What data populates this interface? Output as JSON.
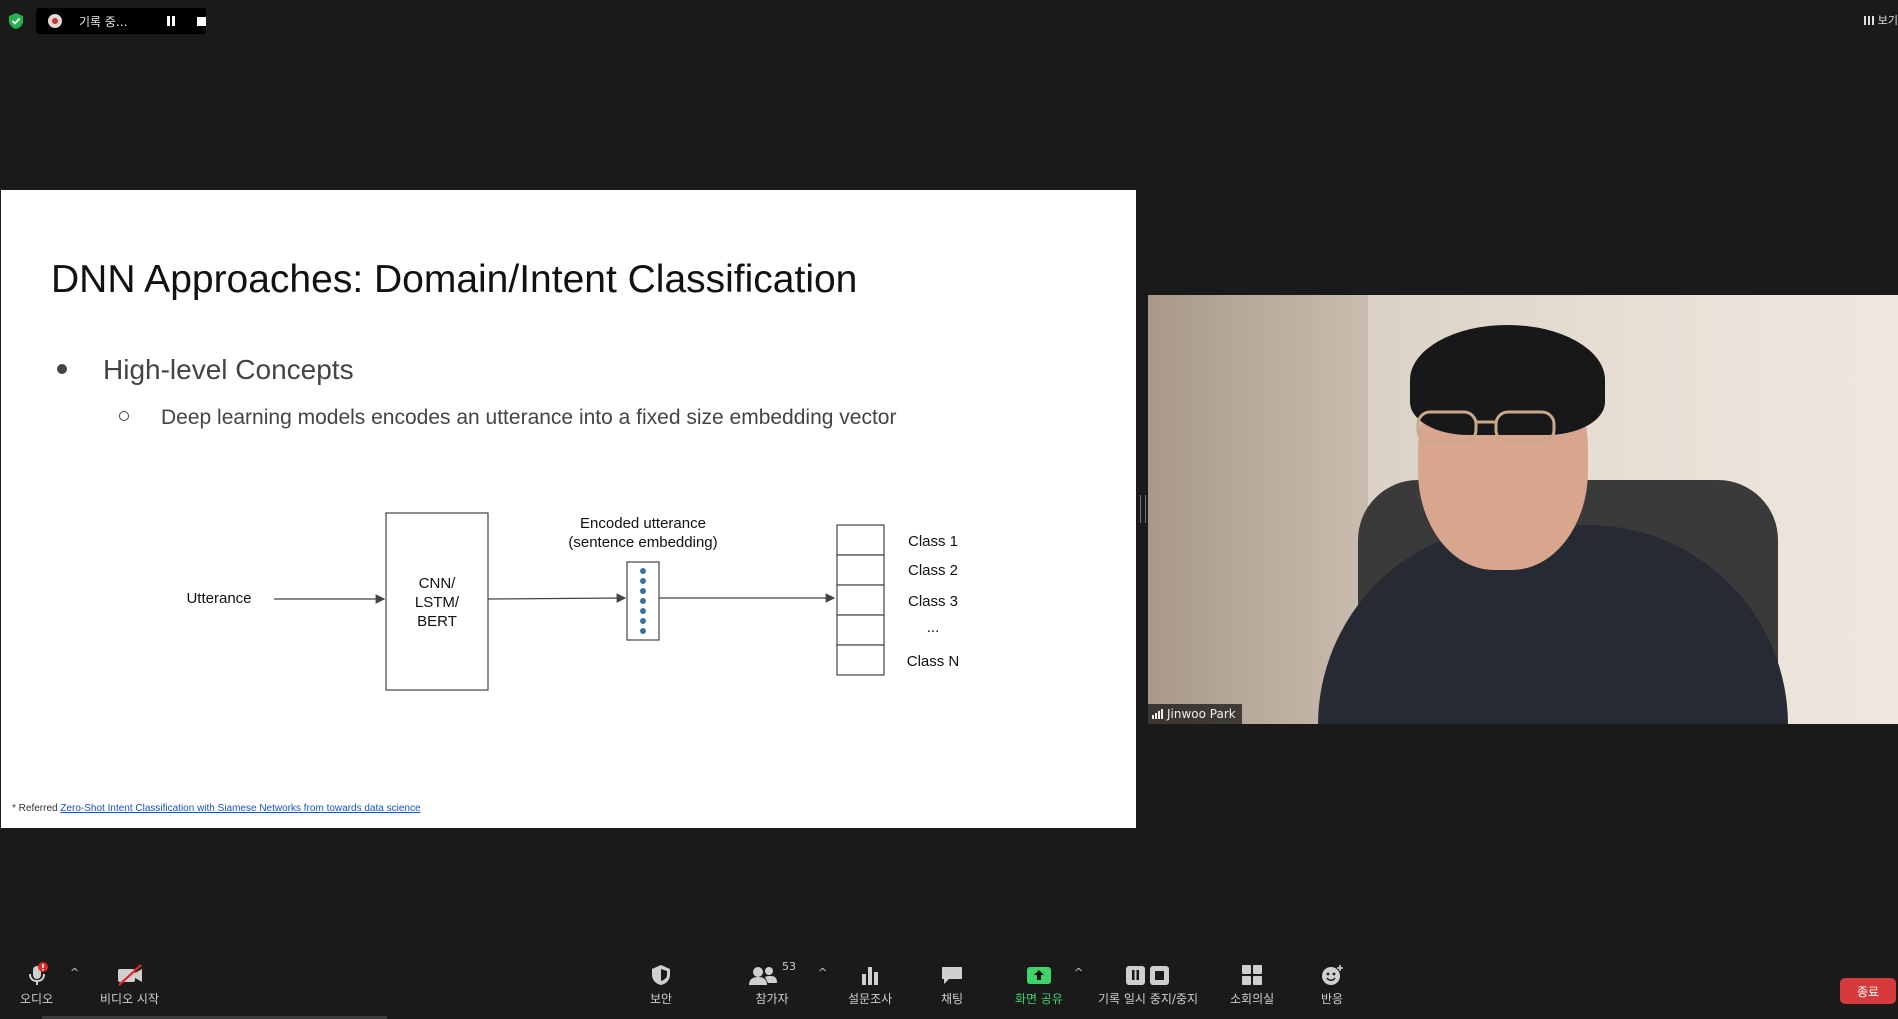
{
  "recording": {
    "label": "기록 중..."
  },
  "view": {
    "label": "보기"
  },
  "slide": {
    "title": "DNN Approaches: Domain/Intent Classification",
    "bullet1": "High-level Concepts",
    "bullet2": "Deep learning models encodes an utterance into a fixed size embedding vector",
    "diagram": {
      "input_label": "Utterance",
      "model_lines": [
        "CNN/",
        "LSTM/",
        "BERT"
      ],
      "encoded_lines": [
        "Encoded utterance",
        "(sentence embedding)"
      ],
      "classes": [
        "Class 1",
        "Class 2",
        "Class 3",
        "...",
        "Class N"
      ]
    },
    "ref_prefix": "* Referred",
    "ref_link": "Zero-Shot Intent Classification with Siamese Networks from towards data science"
  },
  "video": {
    "participant_name": "Jinwoo Park"
  },
  "toolbar": {
    "audio": "오디오",
    "video": "비디오 시작",
    "security": "보안",
    "participants": "참가자",
    "participants_count": "53",
    "polls": "설문조사",
    "chat": "채팅",
    "share": "화면 공유",
    "record": "기록 일시 중지/중지",
    "breakout": "소회의실",
    "reactions": "반응",
    "end": "종료"
  },
  "colors": {
    "share_green": "#3fd36b",
    "end_red": "#d63a3a",
    "link_blue": "#1155cc"
  }
}
